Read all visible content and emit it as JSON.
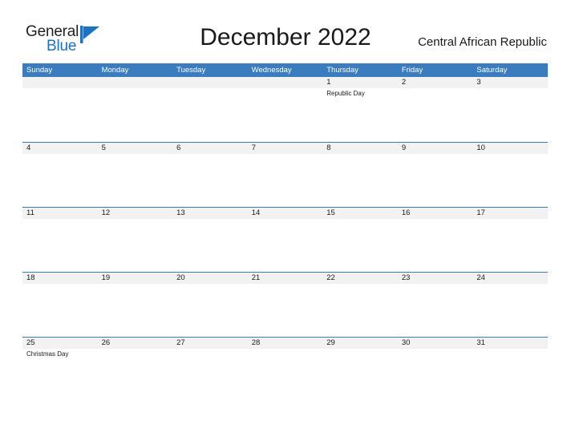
{
  "brand": {
    "word_one": "General",
    "word_two": "Blue",
    "mark_icon": "triangle-flag-icon",
    "accent_color": "#1f72bd"
  },
  "header": {
    "title": "December 2022",
    "region": "Central African Republic"
  },
  "calendar": {
    "header_bg": "#3a7cbd",
    "band_bg": "#f2f2f2",
    "weekdays": [
      "Sunday",
      "Monday",
      "Tuesday",
      "Wednesday",
      "Thursday",
      "Friday",
      "Saturday"
    ],
    "weeks": [
      [
        {
          "date": "",
          "events": []
        },
        {
          "date": "",
          "events": []
        },
        {
          "date": "",
          "events": []
        },
        {
          "date": "",
          "events": []
        },
        {
          "date": "1",
          "events": [
            "Republic Day"
          ]
        },
        {
          "date": "2",
          "events": []
        },
        {
          "date": "3",
          "events": []
        }
      ],
      [
        {
          "date": "4",
          "events": []
        },
        {
          "date": "5",
          "events": []
        },
        {
          "date": "6",
          "events": []
        },
        {
          "date": "7",
          "events": []
        },
        {
          "date": "8",
          "events": []
        },
        {
          "date": "9",
          "events": []
        },
        {
          "date": "10",
          "events": []
        }
      ],
      [
        {
          "date": "11",
          "events": []
        },
        {
          "date": "12",
          "events": []
        },
        {
          "date": "13",
          "events": []
        },
        {
          "date": "14",
          "events": []
        },
        {
          "date": "15",
          "events": []
        },
        {
          "date": "16",
          "events": []
        },
        {
          "date": "17",
          "events": []
        }
      ],
      [
        {
          "date": "18",
          "events": []
        },
        {
          "date": "19",
          "events": []
        },
        {
          "date": "20",
          "events": []
        },
        {
          "date": "21",
          "events": []
        },
        {
          "date": "22",
          "events": []
        },
        {
          "date": "23",
          "events": []
        },
        {
          "date": "24",
          "events": []
        }
      ],
      [
        {
          "date": "25",
          "events": [
            "Christmas Day"
          ]
        },
        {
          "date": "26",
          "events": []
        },
        {
          "date": "27",
          "events": []
        },
        {
          "date": "28",
          "events": []
        },
        {
          "date": "29",
          "events": []
        },
        {
          "date": "30",
          "events": []
        },
        {
          "date": "31",
          "events": []
        }
      ]
    ]
  }
}
